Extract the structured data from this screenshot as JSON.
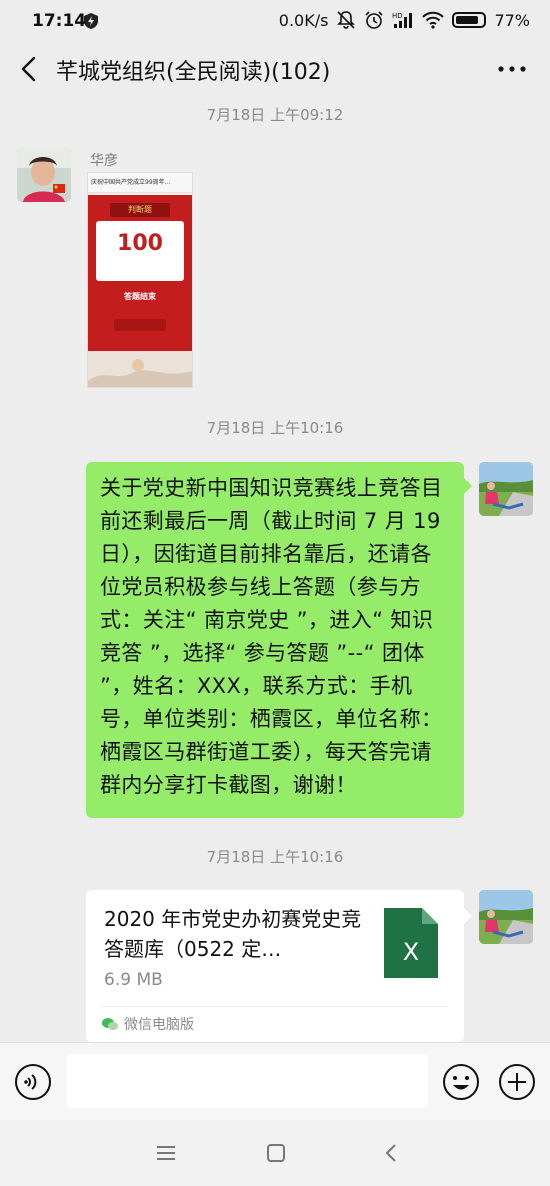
{
  "status_bar": {
    "time": "17:14",
    "network_speed": "0.0K/s",
    "battery": "77%",
    "icons": [
      "shield-icon",
      "mute-bell-icon",
      "alarm-icon",
      "hd-signal-icon",
      "wifi-icon",
      "battery-icon"
    ]
  },
  "nav": {
    "title": "芊城党组织(全民阅读)(102)",
    "back_icon": "chevron-left-icon",
    "more_icon": "more-dots-icon"
  },
  "chat": {
    "timestamps": [
      "7月18日 上午09:12",
      "7月18日 上午10:16",
      "7月18日 上午10:16"
    ],
    "message1": {
      "sender": "华彦",
      "image": {
        "top_text": "庆祝中国共产党成立99周年...",
        "banner": "判断题",
        "score": "100",
        "done_text": "答题结束"
      }
    },
    "message2": {
      "text": "关于党史新中国知识竞赛线上竞答目前还剩最后一周（截止时间 7 月 19 日），因街道目前排名靠后，还请各位党员积极参与线上答题（参与方式：关注“ 南京党史 ”，进入“ 知识竞答 ”，选择“ 参与答题 ”--“ 团体 ”，姓名：XXX，联系方式：手机号，单位类别：栖霞区，单位名称：栖霞区马群街道工委），每天答完请群内分享打卡截图，谢谢！"
    },
    "message3": {
      "file_name": "2020 年市党史办初赛党史竞答题库（0522 定…",
      "file_size": "6.9 MB",
      "file_type_letter": "X",
      "source": "微信电脑版"
    }
  },
  "input_bar": {
    "placeholder": "",
    "voice_icon": "voice-icon",
    "emoji_icon": "emoji-icon",
    "plus_icon": "plus-icon"
  },
  "system_nav": {
    "icons": [
      "menu-icon",
      "home-icon",
      "back-triangle-icon"
    ]
  },
  "colors": {
    "background": "#ededed",
    "my_bubble": "#95ec69",
    "excel_green": "#1f7244"
  }
}
